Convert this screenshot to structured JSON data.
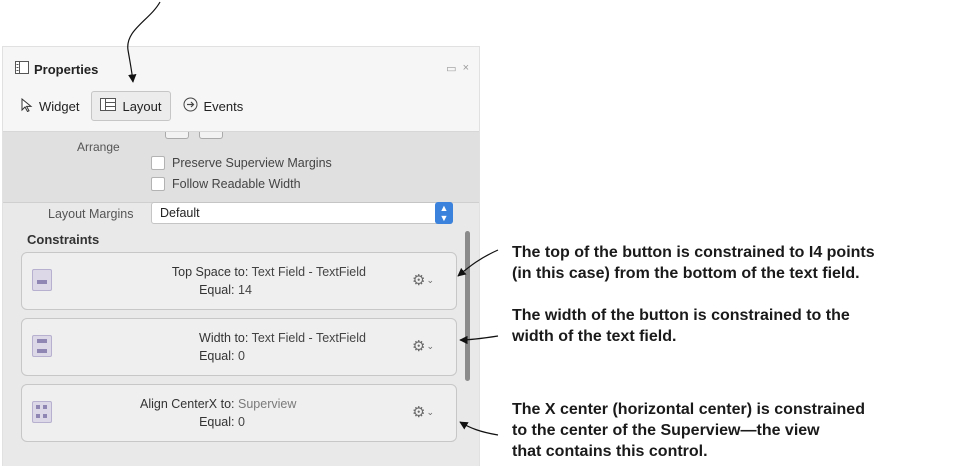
{
  "panel": {
    "title": "Properties",
    "tabs": [
      {
        "label": "Widget"
      },
      {
        "label": "Layout"
      },
      {
        "label": "Events"
      }
    ],
    "arrange_label": "Arrange",
    "checkboxes": [
      {
        "label": "Preserve Superview Margins"
      },
      {
        "label": "Follow Readable Width"
      }
    ],
    "layout_margins_label": "Layout Margins",
    "layout_margins_value": "Default",
    "constraints_heading": "Constraints",
    "constraints": [
      {
        "relation": "Top Space to:",
        "target": "Text Field - TextField",
        "equal_label": "Equal:",
        "constant": "14"
      },
      {
        "relation": "Width to:",
        "target": "Text Field - TextField",
        "equal_label": "Equal:",
        "constant": "0"
      },
      {
        "relation": "Align CenterX to:",
        "target": "Superview",
        "equal_label": "Equal:",
        "constant": "0"
      }
    ]
  },
  "annotations": [
    {
      "lines": [
        "The top of the button is constrained to I4 points",
        "(in this case) from the bottom of the text field."
      ]
    },
    {
      "lines": [
        "The width of the button is constrained to the",
        "width of the text field."
      ]
    },
    {
      "lines": [
        "The X center (horizontal center) is constrained",
        "to the center of the Superview—the view",
        "that contains this control."
      ]
    }
  ]
}
